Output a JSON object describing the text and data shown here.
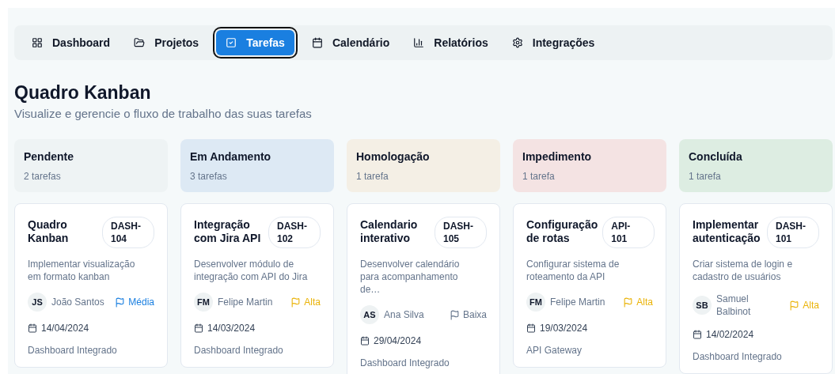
{
  "nav": [
    {
      "label": "Dashboard",
      "selected": false
    },
    {
      "label": "Projetos",
      "selected": false
    },
    {
      "label": "Tarefas",
      "selected": true
    },
    {
      "label": "Calendário",
      "selected": false
    },
    {
      "label": "Relatórios",
      "selected": false
    },
    {
      "label": "Integrações",
      "selected": false
    }
  ],
  "title": "Quadro Kanban",
  "subtitle": "Visualize e gerencie o fluxo de trabalho das suas tarefas",
  "columns": [
    {
      "name": "Pendente",
      "count": "2 tarefas",
      "color": "#eef3f4",
      "cards": [
        {
          "title": "Quadro Kanban",
          "tag": "DASH-104",
          "description": "Implementar visualização em formato kanban",
          "initials": "JS",
          "assignee": "João Santos",
          "priority": {
            "label": "Média",
            "color": "#1a7fe0"
          },
          "date": "14/04/2024",
          "project": "Dashboard Integrado"
        }
      ]
    },
    {
      "name": "Em Andamento",
      "count": "3 tarefas",
      "color": "#dde9f4",
      "cards": [
        {
          "title": "Integração com Jira API",
          "tag": "DASH-102",
          "description": "Desenvolver módulo de integração com API do Jira",
          "initials": "FM",
          "assignee": "Felipe Martin",
          "priority": {
            "label": "Alta",
            "color": "#eab308"
          },
          "date": "14/03/2024",
          "project": "Dashboard Integrado"
        }
      ]
    },
    {
      "name": "Homologação",
      "count": "1 tarefa",
      "color": "#f4efe5",
      "cards": [
        {
          "title": "Calendario interativo",
          "tag": "DASH-105",
          "description": "Desenvolver calendário para acompanhamento de…",
          "initials": "AS",
          "assignee": "Ana Silva",
          "priority": {
            "label": "Baixa",
            "color": "#64748b"
          },
          "date": "29/04/2024",
          "project": "Dashboard Integrado"
        }
      ]
    },
    {
      "name": "Impedimento",
      "count": "1 tarefa",
      "color": "#f4e3e3",
      "cards": [
        {
          "title": "Configuração de rotas",
          "tag": "API-101",
          "description": "Configurar sistema de roteamento da API",
          "initials": "FM",
          "assignee": "Felipe Martin",
          "priority": {
            "label": "Alta",
            "color": "#eab308"
          },
          "date": "19/03/2024",
          "project": "API Gateway"
        }
      ]
    },
    {
      "name": "Concluída",
      "count": "1 tarefa",
      "color": "#ddede2",
      "cards": [
        {
          "title": "Implementar autenticação",
          "tag": "DASH-101",
          "description": "Criar sistema de login e cadastro de usuários",
          "initials": "SB",
          "assignee": "Samuel Balbinot",
          "priority": {
            "label": "Alta",
            "color": "#eab308"
          },
          "date": "14/02/2024",
          "project": "Dashboard Integrado"
        }
      ]
    }
  ]
}
